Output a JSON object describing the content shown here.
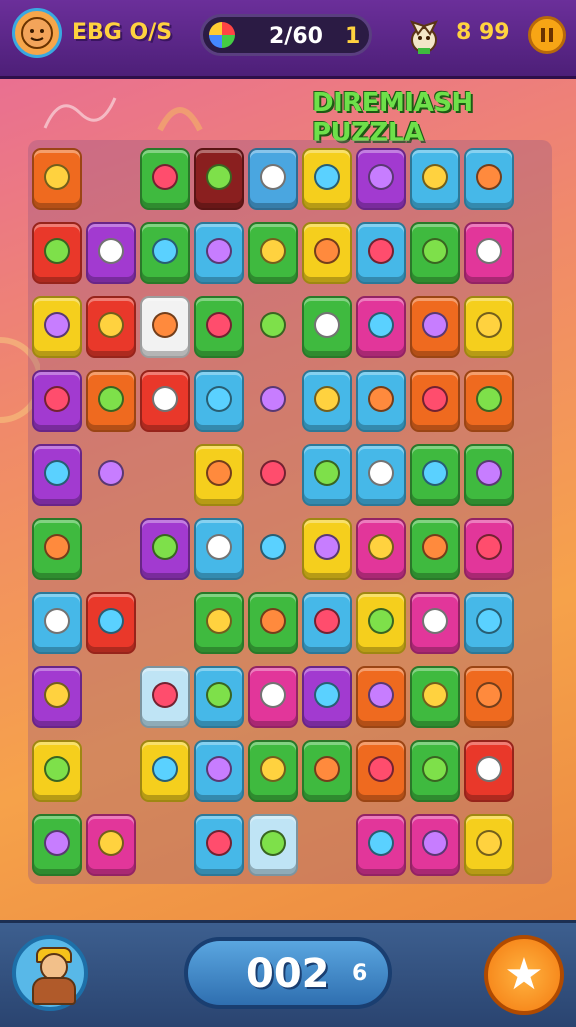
{
  "header": {
    "player_name": "EBG O/S",
    "level_progress": "2/60",
    "level_number": "1",
    "coins": "8 99",
    "pause_icon": "pause-icon",
    "pet_icon": "pet-icon"
  },
  "title": "DIREMIASH PUZZLA",
  "footer": {
    "score": "002",
    "score_extra": "6",
    "star_icon": "star-icon"
  },
  "colors": {
    "topbar": "#5a2585",
    "title": "#6ee04a",
    "coin": "#ffd23f",
    "score_pill": "#3f88c8",
    "star_button": "#f47a10"
  },
  "board": {
    "rows": [
      [
        {
          "c": "#ef6a1f",
          "i": "carrot"
        },
        {
          "c": "",
          "i": ""
        },
        {
          "c": "#3fba3f",
          "i": "orange"
        },
        {
          "c": "#8a1f1f",
          "i": "cone"
        },
        {
          "c": "#4aa6e0",
          "i": "flower"
        },
        {
          "c": "#f5cf1d",
          "i": "icecream"
        },
        {
          "c": "#a23ad0",
          "i": "brush"
        },
        {
          "c": "#46b8e8",
          "i": "icecream"
        },
        {
          "c": "#46b8e8",
          "i": "mask"
        },
        {
          "c": "",
          "i": ""
        }
      ],
      [
        {
          "c": "#e9382a",
          "i": "lemon"
        },
        {
          "c": "#a23ad0",
          "i": "shell"
        },
        {
          "c": "#3fba3f",
          "i": "leaf"
        },
        {
          "c": "#46b8e8",
          "i": "bottle"
        },
        {
          "c": "#3fba3f",
          "i": "heart"
        },
        {
          "c": "#f5cf1d",
          "i": "chili"
        },
        {
          "c": "#46b8e8",
          "i": "robot"
        },
        {
          "c": "#3fba3f",
          "i": "heart"
        },
        {
          "c": "#e2369a",
          "i": "feather"
        },
        {
          "c": "",
          "i": ""
        }
      ],
      [
        {
          "c": "#f5cf1d",
          "i": "robot"
        },
        {
          "c": "#e9382a",
          "i": "ticket"
        },
        {
          "c": "#f2f2f2",
          "i": "leaf"
        },
        {
          "c": "#3fba3f",
          "i": "monster"
        },
        {
          "c": "",
          "i": "drum"
        },
        {
          "c": "#3fba3f",
          "i": "star"
        },
        {
          "c": "#e2369a",
          "i": "kite"
        },
        {
          "c": "#ef6a1f",
          "i": "anchor"
        },
        {
          "c": "#f5cf1d",
          "i": "diamond"
        },
        {
          "c": "",
          "i": ""
        }
      ],
      [
        {
          "c": "#a23ad0",
          "i": "heart"
        },
        {
          "c": "#ef6a1f",
          "i": "palm"
        },
        {
          "c": "#e9382a",
          "i": "phone"
        },
        {
          "c": "#46b8e8",
          "i": "heart"
        },
        {
          "c": "",
          "i": "snail"
        },
        {
          "c": "#46b8e8",
          "i": "cone"
        },
        {
          "c": "#46b8e8",
          "i": "apple"
        },
        {
          "c": "#ef6a1f",
          "i": "face"
        },
        {
          "c": "#ef6a1f",
          "i": "pumpkin"
        },
        {
          "c": "",
          "i": ""
        }
      ],
      [
        {
          "c": "#a23ad0",
          "i": "robot"
        },
        {
          "c": "",
          "i": "bird"
        },
        {
          "c": "",
          "i": ""
        },
        {
          "c": "#f5cf1d",
          "i": "smile"
        },
        {
          "c": "",
          "i": "cheese"
        },
        {
          "c": "#46b8e8",
          "i": "flower"
        },
        {
          "c": "#46b8e8",
          "i": "apple"
        },
        {
          "c": "#3fba3f",
          "i": "heart"
        },
        {
          "c": "#3fba3f",
          "i": "carrot"
        },
        {
          "c": "",
          "i": ""
        }
      ],
      [
        {
          "c": "#3fba3f",
          "i": "plum"
        },
        {
          "c": "",
          "i": ""
        },
        {
          "c": "#a23ad0",
          "i": "frog"
        },
        {
          "c": "#46b8e8",
          "i": "bird"
        },
        {
          "c": "",
          "i": "bow"
        },
        {
          "c": "#f5cf1d",
          "i": "cloud"
        },
        {
          "c": "#e2369a",
          "i": "icecream"
        },
        {
          "c": "#3fba3f",
          "i": "cherry"
        },
        {
          "c": "#e2369a",
          "i": "bowl"
        },
        {
          "c": "",
          "i": ""
        }
      ],
      [
        {
          "c": "#46b8e8",
          "i": "pencil"
        },
        {
          "c": "#e9382a",
          "i": "shell"
        },
        {
          "c": "",
          "i": ""
        },
        {
          "c": "#3fba3f",
          "i": "leaf"
        },
        {
          "c": "#3fba3f",
          "i": "lemon"
        },
        {
          "c": "#46b8e8",
          "i": "leaf"
        },
        {
          "c": "#f5cf1d",
          "i": "pepper"
        },
        {
          "c": "#e2369a",
          "i": "flower"
        },
        {
          "c": "#46b8e8",
          "i": "ball"
        },
        {
          "c": "",
          "i": ""
        }
      ],
      [
        {
          "c": "#a23ad0",
          "i": "pencil"
        },
        {
          "c": "",
          "i": ""
        },
        {
          "c": "#bfe4f5",
          "i": "icecream"
        },
        {
          "c": "#46b8e8",
          "i": "bag"
        },
        {
          "c": "#e2369a",
          "i": "feather"
        },
        {
          "c": "#a23ad0",
          "i": "star"
        },
        {
          "c": "#ef6a1f",
          "i": "swirl"
        },
        {
          "c": "#3fba3f",
          "i": "leaf"
        },
        {
          "c": "#ef6a1f",
          "i": "palm"
        },
        {
          "c": "",
          "i": ""
        }
      ],
      [
        {
          "c": "#f5cf1d",
          "i": "face"
        },
        {
          "c": "",
          "i": ""
        },
        {
          "c": "#f5cf1d",
          "i": "heart"
        },
        {
          "c": "#46b8e8",
          "i": "face"
        },
        {
          "c": "#3fba3f",
          "i": "lemon"
        },
        {
          "c": "#3fba3f",
          "i": "pencil"
        },
        {
          "c": "#ef6a1f",
          "i": "robot"
        },
        {
          "c": "#3fba3f",
          "i": "lemon"
        },
        {
          "c": "#e9382a",
          "i": "clip"
        },
        {
          "c": "",
          "i": ""
        }
      ],
      [
        {
          "c": "#3fba3f",
          "i": "pencil"
        },
        {
          "c": "#e2369a",
          "i": "bird"
        },
        {
          "c": "",
          "i": ""
        },
        {
          "c": "#46b8e8",
          "i": "broom"
        },
        {
          "c": "#bfe4f5",
          "i": "orb"
        },
        {
          "c": "",
          "i": ""
        },
        {
          "c": "#e2369a",
          "i": "apple"
        },
        {
          "c": "#e2369a",
          "i": "plum"
        },
        {
          "c": "#f5cf1d",
          "i": "box"
        },
        {
          "c": "",
          "i": ""
        }
      ]
    ]
  }
}
